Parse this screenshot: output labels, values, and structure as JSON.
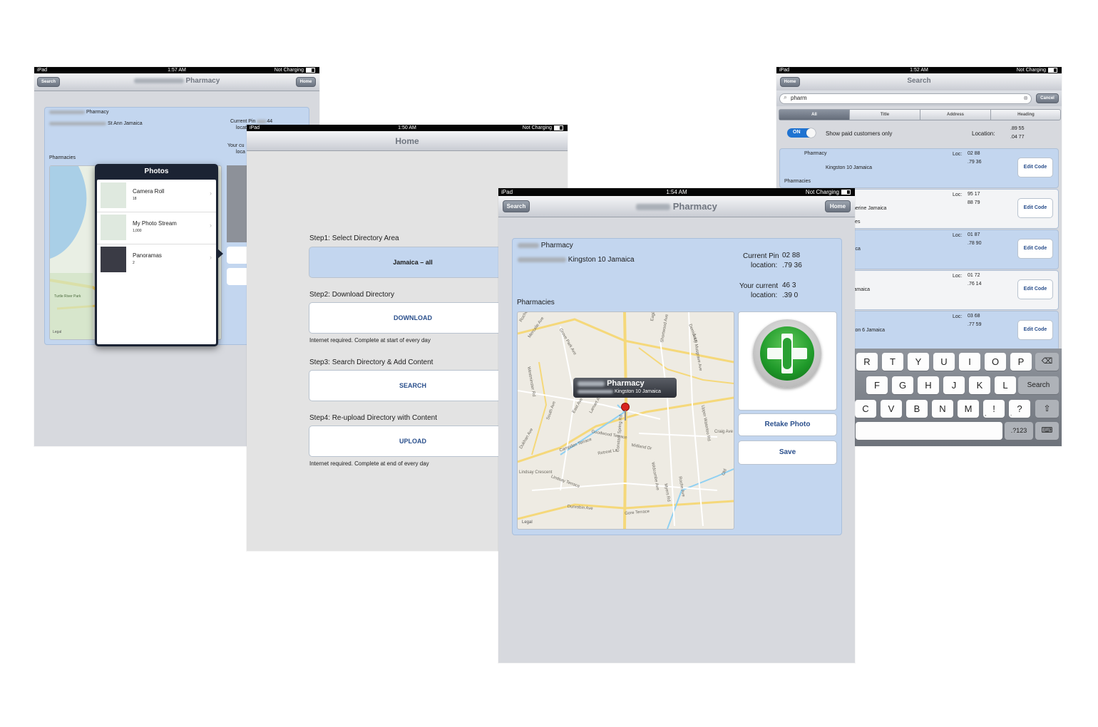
{
  "status": {
    "device": "iPad",
    "charging": "Not Charging",
    "times": {
      "s1": "1:57 AM",
      "s2": "1:50 AM",
      "s3": "1:54 AM",
      "s4": "1:52 AM"
    }
  },
  "screen1": {
    "back_label": "Search",
    "home_label": "Home",
    "title": "Pharmacy",
    "name": "Pharmacy",
    "address": "St Ann Jamaica",
    "pin_label_1": "Current Pin",
    "pin_label_2": "locati",
    "pin_value": "44",
    "current_label_1": "Your cu",
    "current_label_2": "loca",
    "section": "Pharmacies",
    "legal": "Legal",
    "map_place": "Turtle River Park",
    "popover": {
      "title": "Photos",
      "items": [
        {
          "label": "Camera Roll",
          "count": "18"
        },
        {
          "label": "My Photo Stream",
          "count": "1,000"
        },
        {
          "label": "Panoramas",
          "count": "2"
        }
      ]
    }
  },
  "screen2": {
    "title": "Home",
    "step1": "Step1: Select Directory Area",
    "area": "Jamaica – all",
    "step2": "Step2: Download Directory",
    "download": "DOWNLOAD",
    "note1": "Internet required. Complete at start of every day",
    "step3": "Step3: Search Directory & Add Content",
    "search": "SEARCH",
    "step4": "Step4: Re-upload Directory with Content",
    "upload": "UPLOAD",
    "note2": "Internet required. Complete at end of every day"
  },
  "screen3": {
    "back_label": "Search",
    "home_label": "Home",
    "title": "Pharmacy",
    "name": "Pharmacy",
    "address": "Kingston 10 Jamaica",
    "pin_label_1": "Current Pin",
    "pin_label_2": "location:",
    "pin_val_1": "02 88",
    "pin_val_2": ".79 36",
    "current_label_1": "Your current",
    "current_label_2": "location:",
    "cur_val_1": "46 3",
    "cur_val_2": ".39 0",
    "section": "Pharmacies",
    "callout_title": "Pharmacy",
    "callout_sub": "Kingston 10 Jamaica",
    "legal": "Legal",
    "retake": "Retake Photo",
    "save": "Save",
    "streets": [
      "Rochester Ave",
      "Mercalie Ave",
      "Grove Park Ave",
      "Eagle Ave",
      "Shortwood Ave",
      "Derrick Ln",
      "Lady Musgrave Ave",
      "Westminster Rd",
      "South Ave",
      "East Ave",
      "Lamart Ave",
      "Goodwood Terrace",
      "Campden Terrace",
      "Retreat Ln",
      "Midland Dr",
      "Constant Spring Rd",
      "Widcombe Ave",
      "Upper Waterloo Rd",
      "Craig Ave",
      "Dunrobin Ave",
      "Gore Terrace",
      "Lindsay Crescent",
      "Lindsay Terrace",
      "Roche Ave",
      "Myers Rd",
      "Dukhan Ave",
      "Old"
    ]
  },
  "screen4": {
    "home_label": "Home",
    "title": "Search",
    "query": "pharm",
    "cancel": "Cancel",
    "segments": [
      "All",
      "Title",
      "Address",
      "Heading"
    ],
    "toggle": "ON",
    "toggle_label": "Show paid customers only",
    "location_label": "Location:",
    "loc_val_1": ".89 55",
    "loc_val_2": ".04 77",
    "rows": [
      {
        "name": "Pharmacy",
        "addr": "Kingston 10 Jamaica",
        "heading": "Pharmacies",
        "loc": "Loc:",
        "v1": "02 88",
        "v2": ".79 36",
        "btn": "Edit Code"
      },
      {
        "name": "",
        "addr": "therine Jamaica",
        "heading": "cies",
        "loc": "Loc:",
        "v1": "95 17",
        "v2": "88 79",
        "btn": "Edit Code"
      },
      {
        "name": "",
        "addr": "aica",
        "heading": "",
        "loc": "Loc:",
        "v1": "01 87",
        "v2": ".78 90",
        "btn": "Edit Code"
      },
      {
        "name": "",
        "addr": "Jamaica",
        "heading": "",
        "loc": "Loc:",
        "v1": "01 72",
        "v2": ".76 14",
        "btn": "Edit Code"
      },
      {
        "name": "",
        "addr": "ston 6 Jamaica",
        "heading": "",
        "loc": "Loc:",
        "v1": "03 68",
        "v2": ".77 59",
        "btn": "Edit Code"
      }
    ],
    "keyboard": {
      "row1": [
        "R",
        "T",
        "Y",
        "U",
        "I",
        "O",
        "P"
      ],
      "row2": [
        "F",
        "G",
        "H",
        "J",
        "K",
        "L"
      ],
      "search_key": "Search",
      "row3": [
        "C",
        "V",
        "B",
        "N",
        "M",
        "!",
        "?"
      ],
      "row3_sub": [
        ",",
        "."
      ],
      "num_key": ".?123"
    }
  },
  "colors": {
    "panel": "#c3d6ef",
    "accent": "#2a4f8c",
    "nav": "#707680",
    "pharmacy_green": "#1f9a2a"
  }
}
